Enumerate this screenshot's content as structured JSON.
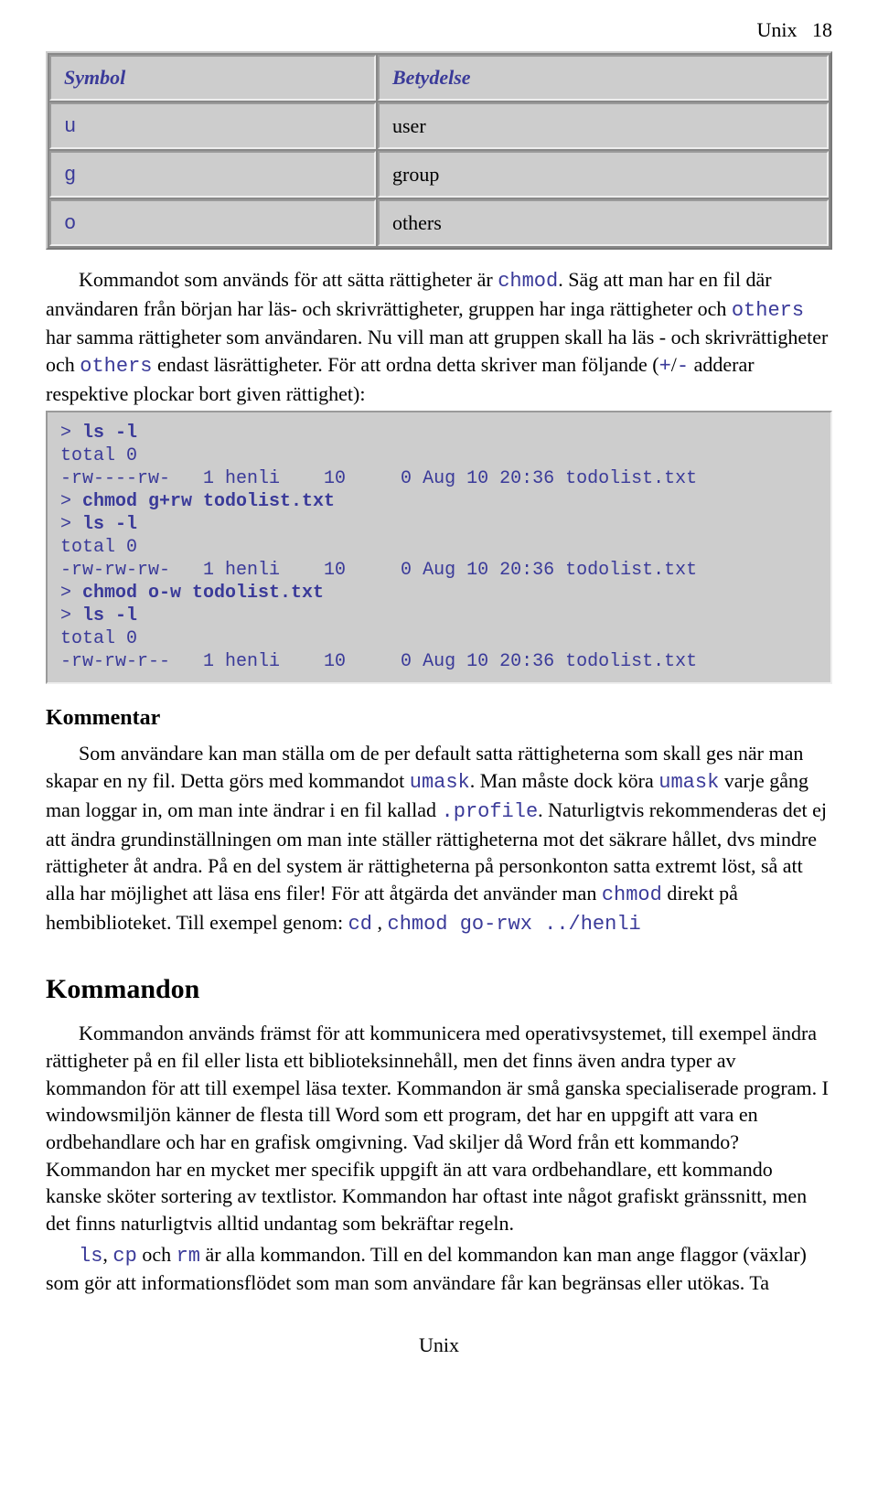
{
  "header": {
    "title": "Unix",
    "page": "18"
  },
  "table": {
    "col1": "Symbol",
    "col2": "Betydelse",
    "rows": [
      {
        "sym": "u",
        "meaning": "user"
      },
      {
        "sym": "g",
        "meaning": "group"
      },
      {
        "sym": "o",
        "meaning": "others"
      }
    ]
  },
  "para1": {
    "t1": "Kommandot som används för att sätta rättigheter är ",
    "c1": "chmod",
    "t2": ". Säg att man har en fil där användaren från början har läs- och skrivrättigheter, gruppen har inga rättigheter och ",
    "c2": "others",
    "t3": " har samma rättigheter som användaren. Nu vill man att gruppen skall ha läs - och skrivrättigheter och ",
    "c3": "others",
    "t4": " endast läsrättigheter. För att ordna detta skriver man följande (",
    "c4": "+",
    "t5": "/",
    "c5": "-",
    "t6": " adderar respektive plockar bort given rättighet):"
  },
  "code1": {
    "l1a": "> ",
    "l1b": "ls -l",
    "l2": "total 0",
    "l3": "-rw----rw-   1 henli    10     0 Aug 10 20:36 todolist.txt",
    "l4a": "> ",
    "l4b": "chmod g+rw todolist.txt",
    "l5a": "> ",
    "l5b": "ls -l",
    "l6": "total 0",
    "l7": "-rw-rw-rw-   1 henli    10     0 Aug 10 20:36 todolist.txt",
    "l8a": "> ",
    "l8b": "chmod o-w todolist.txt",
    "l9a": "> ",
    "l9b": "ls -l",
    "l10": "total 0",
    "l11": "-rw-rw-r--   1 henli    10     0 Aug 10 20:36 todolist.txt"
  },
  "kom": {
    "heading": "Kommentar",
    "p1a": "Som användare kan man ställa om de per default satta rättigheterna som skall ges när man skapar en ny fil. Detta görs med kommandot ",
    "c1": "umask",
    "p1b": ". Man måste dock köra ",
    "c2": "umask",
    "p1c": " varje gång man loggar in, om man inte ändrar i en fil kallad ",
    "c3": ".profile",
    "p1d": ". Naturligtvis rekommenderas det ej att ändra grundinställningen om man inte ställer rättigheterna mot det säkrare hållet, dvs mindre rättigheter åt andra. På en del system är rättigheterna på personkonton satta extremt löst, så att alla har möjlighet att läsa ens filer! För att åtgärda det använder man ",
    "c4": "chmod",
    "p1e": " direkt på hembiblioteket. Till exempel genom: ",
    "c5": "cd",
    "p1f": " , ",
    "c6": "chmod go-rwx ../henli"
  },
  "sec": {
    "heading": "Kommandon",
    "p1": "Kommandon används främst för att kommunicera med operativsystemet, till exempel ändra rättigheter på en fil eller lista ett biblioteksinnehåll, men det finns även andra typer av kommandon för att till exempel läsa texter. Kommandon är små ganska specialiserade program. I windowsmiljön känner de flesta till Word som ett program, det har en uppgift att vara en ordbehandlare och har en grafisk omgivning. Vad skiljer då Word från ett kommando? Kommandon har en mycket mer specifik uppgift än att vara ordbehandlare, ett kommando kanske sköter sortering av textlistor. Kommandon har oftast inte något grafiskt gränssnitt, men det finns naturligtvis alltid undantag som bekräftar regeln.",
    "p2a": "ls",
    "p2b": ", ",
    "p2c": "cp",
    "p2d": " och ",
    "p2e": "rm",
    "p2f": " är alla kommandon. Till en del kommandon kan man ange flaggor (växlar) som gör att informationsflödet som man som användare får kan begränsas eller utökas. Ta"
  },
  "footer": "Unix"
}
